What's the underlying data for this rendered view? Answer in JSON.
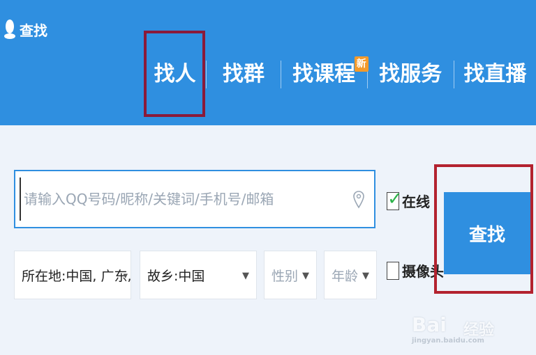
{
  "app": {
    "title": "查找"
  },
  "tabs": [
    {
      "label": "找人",
      "active": true
    },
    {
      "label": "找群"
    },
    {
      "label": "找课程",
      "badge": "新"
    },
    {
      "label": "找服务"
    },
    {
      "label": "找直播"
    }
  ],
  "search": {
    "placeholder": "请输入QQ号码/昵称/关键词/手机号/邮箱",
    "value": ""
  },
  "filters": {
    "online_label": "在线",
    "online_checked": true,
    "camera_label": "摄像头",
    "camera_checked": false,
    "location": "所在地:中国, 广东, 韶关",
    "hometown": "故乡:中国",
    "gender": "性别",
    "age": "年龄"
  },
  "find_button": {
    "label": "查找"
  },
  "watermark": {
    "text": "Bai",
    "sub": "经验",
    "url": "jingyan.baidu.com"
  },
  "colors": {
    "header": "#2f8fe0",
    "highlight_frame_tab": "#8a1a3a",
    "highlight_frame_button": "#b3222f",
    "badge": "#f39a2b",
    "check": "#2db34a"
  }
}
